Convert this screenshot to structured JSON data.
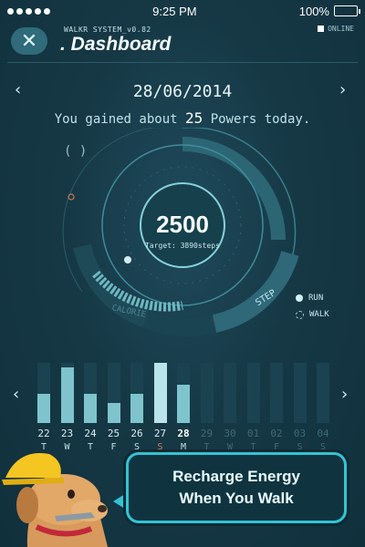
{
  "status": {
    "time": "9:25 PM",
    "battery": "100%"
  },
  "header": {
    "system_label": "WALKR SYSTEM_v0.82",
    "title": ". Dashboard",
    "online_label": "ONLINE",
    "close_glyph": "✕"
  },
  "date_nav": {
    "date": "28/06/2014",
    "prev": "‹",
    "next": "›"
  },
  "summary": {
    "prefix": "You gained about ",
    "powers": "25",
    "suffix": " Powers today."
  },
  "gauge": {
    "steps": "2500",
    "target_label": "Target: 3890",
    "target_unit": "steps",
    "steps_value": 2500,
    "target_value": 3890,
    "segments": [
      "CALORIE",
      "STEP"
    ]
  },
  "legend": {
    "run": "RUN",
    "walk": "WALK"
  },
  "history": {
    "prev": "‹",
    "next": "›",
    "days": [
      {
        "day": "22",
        "wd": "T",
        "level": 0.48,
        "state": "past"
      },
      {
        "day": "23",
        "wd": "W",
        "level": 0.92,
        "state": "past"
      },
      {
        "day": "24",
        "wd": "T",
        "level": 0.48,
        "state": "past"
      },
      {
        "day": "25",
        "wd": "F",
        "level": 0.34,
        "state": "past"
      },
      {
        "day": "26",
        "wd": "S",
        "level": 0.48,
        "state": "past"
      },
      {
        "day": "27",
        "wd": "S",
        "level": 1.0,
        "state": "sunday"
      },
      {
        "day": "28",
        "wd": "M",
        "level": 0.64,
        "state": "today"
      },
      {
        "day": "29",
        "wd": "T",
        "level": 0.0,
        "state": "future"
      },
      {
        "day": "30",
        "wd": "W",
        "level": 0.0,
        "state": "future"
      },
      {
        "day": "01",
        "wd": "T",
        "level": 0.0,
        "state": "future"
      },
      {
        "day": "02",
        "wd": "F",
        "level": 0.0,
        "state": "future"
      },
      {
        "day": "03",
        "wd": "S",
        "level": 0.0,
        "state": "future"
      },
      {
        "day": "04",
        "wd": "S",
        "level": 0.0,
        "state": "future"
      }
    ]
  },
  "banner": {
    "line1": "Recharge Energy",
    "line2": "When You Walk"
  },
  "colors": {
    "accent": "#34c3d4",
    "bar": "#7fc4cc",
    "background": "#163845"
  }
}
